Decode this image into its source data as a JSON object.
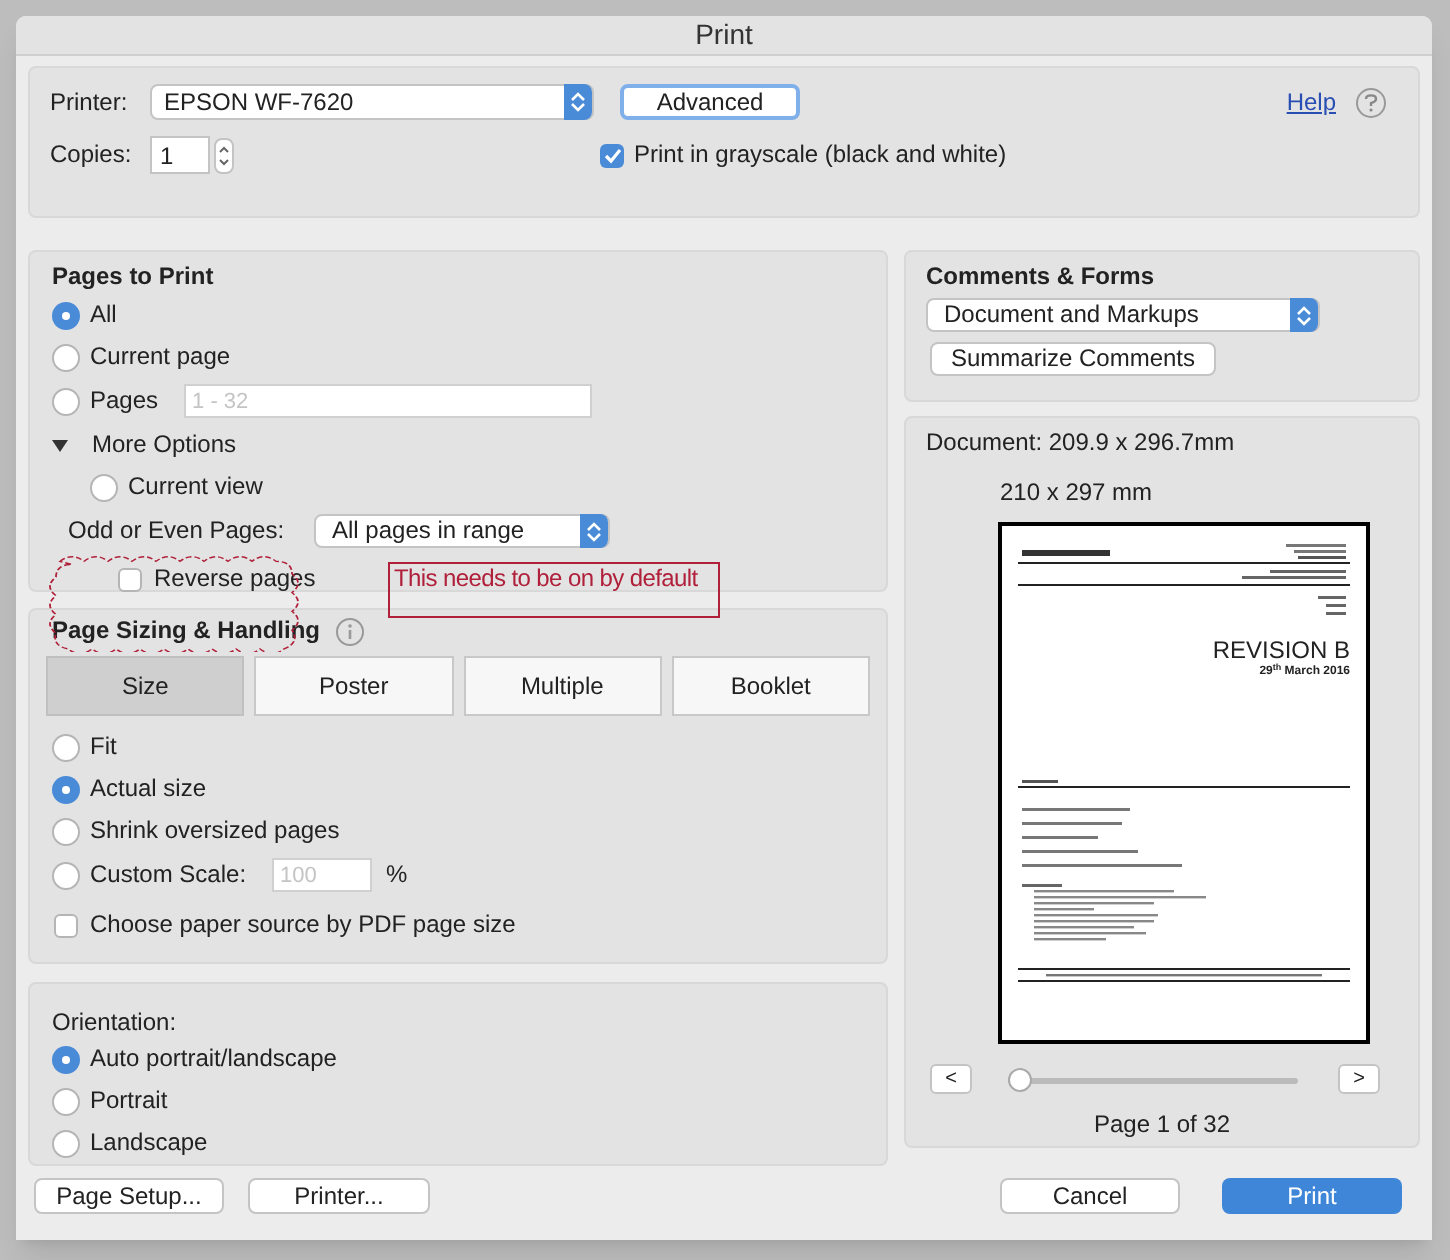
{
  "window": {
    "title": "Print"
  },
  "printer": {
    "label": "Printer:",
    "value": "EPSON WF-7620"
  },
  "advanced_button": "Advanced",
  "help_link": "Help",
  "copies": {
    "label": "Copies:",
    "value": "1"
  },
  "grayscale": {
    "label": "Print in grayscale (black and white)",
    "checked": true
  },
  "pages_to_print": {
    "title": "Pages to Print",
    "options": [
      {
        "label": "All",
        "selected": true
      },
      {
        "label": "Current page",
        "selected": false
      },
      {
        "label": "Pages",
        "selected": false,
        "placeholder": "1 - 32"
      }
    ],
    "more_options": {
      "label": "More Options",
      "expanded": true,
      "current_view": {
        "label": "Current view",
        "selected": false
      },
      "odd_even": {
        "label": "Odd or Even Pages:",
        "value": "All pages in range"
      },
      "reverse_pages": {
        "label": "Reverse pages",
        "checked": false
      }
    }
  },
  "annotation": {
    "text": "This needs to be on by default"
  },
  "page_sizing": {
    "title": "Page Sizing & Handling",
    "tabs": [
      {
        "label": "Size",
        "selected": true
      },
      {
        "label": "Poster",
        "selected": false
      },
      {
        "label": "Multiple",
        "selected": false
      },
      {
        "label": "Booklet",
        "selected": false
      }
    ],
    "options": [
      {
        "label": "Fit",
        "selected": false
      },
      {
        "label": "Actual size",
        "selected": true
      },
      {
        "label": "Shrink oversized pages",
        "selected": false
      },
      {
        "label": "Custom Scale:",
        "selected": false,
        "placeholder": "100",
        "unit": "%"
      }
    ],
    "paper_source": {
      "label": "Choose paper source by PDF page size",
      "checked": false
    }
  },
  "orientation": {
    "title": "Orientation:",
    "options": [
      {
        "label": "Auto portrait/landscape",
        "selected": true
      },
      {
        "label": "Portrait",
        "selected": false
      },
      {
        "label": "Landscape",
        "selected": false
      }
    ]
  },
  "comments_forms": {
    "title": "Comments & Forms",
    "value": "Document and Markups",
    "button": "Summarize Comments"
  },
  "preview": {
    "document_size": "Document: 209.9 x 296.7mm",
    "paper_size": "210 x 297 mm",
    "page_heading": "REVISION B",
    "page_date": "29$^{th}$ March 2016",
    "prev": "<",
    "next": ">",
    "level": 0,
    "page_label": "Page 1 of 32"
  },
  "buttons": {
    "page_setup": "Page Setup...",
    "printer": "Printer...",
    "cancel": "Cancel",
    "print": "Print"
  }
}
